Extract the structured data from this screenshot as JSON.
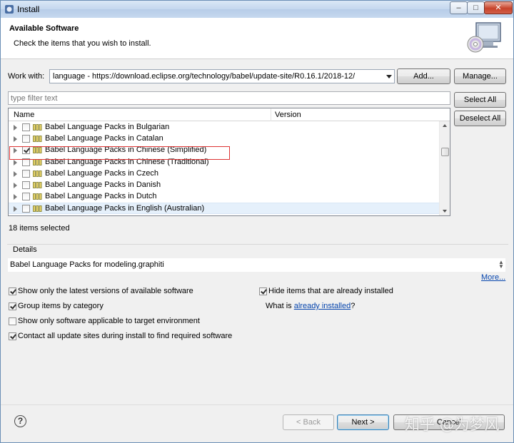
{
  "window": {
    "title": "Install",
    "min_glyph": "–",
    "max_glyph": "□",
    "close_glyph": "✕"
  },
  "header": {
    "title": "Available Software",
    "description": "Check the items that you wish to install.",
    "icon": "install-cd-icon"
  },
  "work_with": {
    "label": "Work with:",
    "value": "language - https://download.eclipse.org/technology/babel/update-site/R0.16.1/2018-12/",
    "add_label": "Add...",
    "manage_label": "Manage..."
  },
  "filter": {
    "placeholder": "type filter text"
  },
  "side_buttons": {
    "select_all": "Select All",
    "deselect_all": "Deselect All"
  },
  "tree": {
    "columns": [
      "Name",
      "Version"
    ],
    "rows": [
      {
        "name": "Babel Language Packs in Bulgarian",
        "checked": false
      },
      {
        "name": "Babel Language Packs in Catalan",
        "checked": false
      },
      {
        "name": "Babel Language Packs in Chinese (Simplified)",
        "checked": true
      },
      {
        "name": "Babel Language Packs in Chinese (Traditional)",
        "checked": false
      },
      {
        "name": "Babel Language Packs in Czech",
        "checked": false
      },
      {
        "name": "Babel Language Packs in Danish",
        "checked": false
      },
      {
        "name": "Babel Language Packs in Dutch",
        "checked": false
      },
      {
        "name": "Babel Language Packs in English (Australian)",
        "checked": false
      }
    ]
  },
  "status": {
    "selected": "18 items selected"
  },
  "details": {
    "label": "Details",
    "text": "Babel Language Packs for modeling.graphiti",
    "more_link": "More..."
  },
  "options": {
    "latest_versions": {
      "label": "Show only the latest versions of available software",
      "checked": true
    },
    "group_by_category": {
      "label": "Group items by category",
      "checked": true
    },
    "target_env": {
      "label": "Show only software applicable to target environment",
      "checked": false
    },
    "contact_sites": {
      "label": "Contact all update sites during install to find required software",
      "checked": true
    },
    "hide_installed": {
      "label": "Hide items that are already installed",
      "checked": true
    },
    "what_is_prefix": "What is ",
    "already_installed_link": "already installed",
    "what_is_suffix": "?"
  },
  "footer": {
    "help_glyph": "?",
    "back_label": "< Back",
    "next_label": "Next >",
    "cancel_label": "Cancel",
    "watermark": "知乎 @为梦风"
  }
}
